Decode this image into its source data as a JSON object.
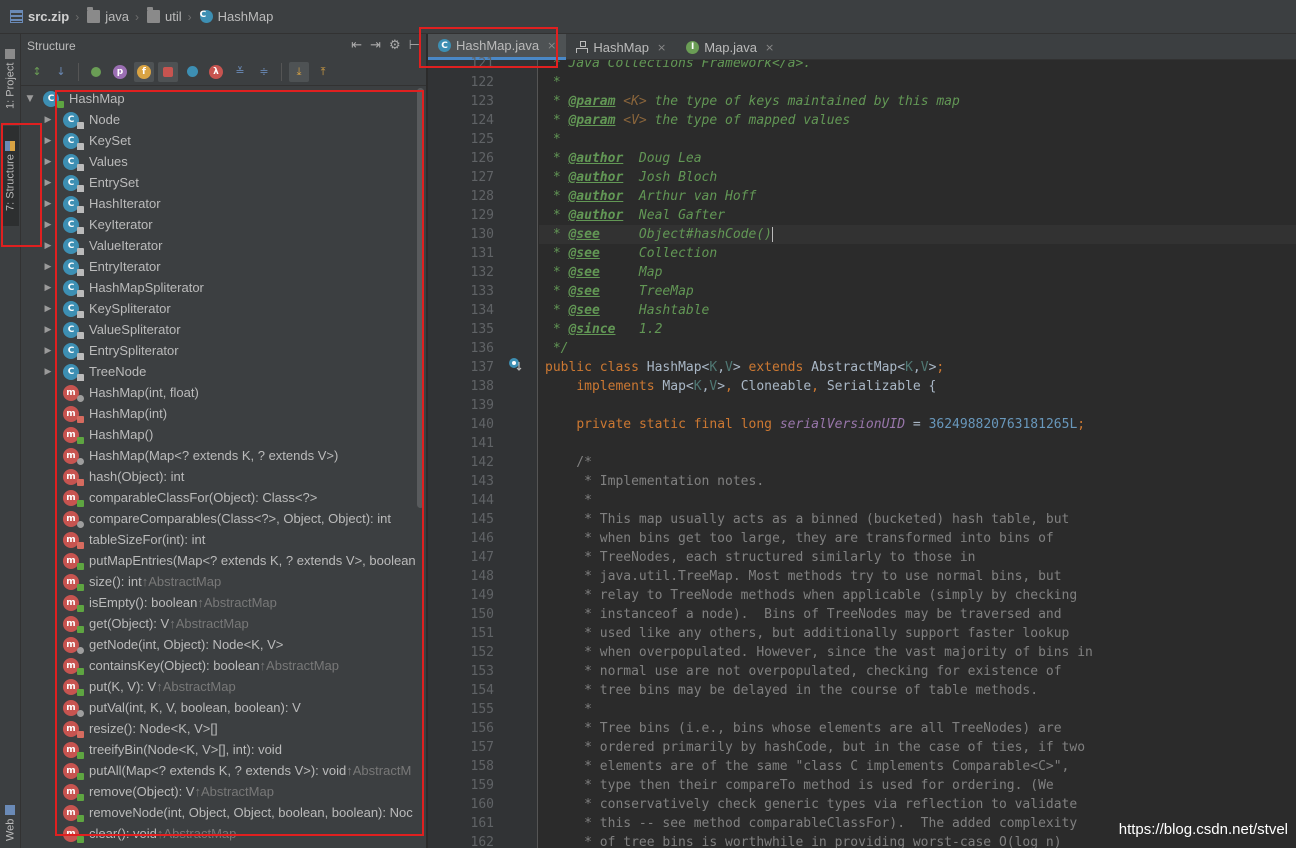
{
  "breadcrumb": {
    "items": [
      {
        "label": "src.zip",
        "icon": "zip-archive-icon"
      },
      {
        "label": "java",
        "icon": "folder-icon"
      },
      {
        "label": "util",
        "icon": "folder-icon"
      },
      {
        "label": "HashMap",
        "icon": "class-icon"
      }
    ]
  },
  "left_strip": {
    "project_tab": "1: Project",
    "structure_tab": "7: Structure",
    "web_tab": "Web"
  },
  "structure": {
    "title": "Structure",
    "root": "HashMap",
    "items": [
      {
        "kind": "class",
        "label": "Node",
        "inherited": "",
        "expandable": true
      },
      {
        "kind": "class",
        "label": "KeySet",
        "inherited": "",
        "expandable": true
      },
      {
        "kind": "class",
        "label": "Values",
        "inherited": "",
        "expandable": true
      },
      {
        "kind": "class",
        "label": "EntrySet",
        "inherited": "",
        "expandable": true
      },
      {
        "kind": "class",
        "label": "HashIterator",
        "inherited": "",
        "expandable": true
      },
      {
        "kind": "class",
        "label": "KeyIterator",
        "inherited": "",
        "expandable": true
      },
      {
        "kind": "class",
        "label": "ValueIterator",
        "inherited": "",
        "expandable": true
      },
      {
        "kind": "class",
        "label": "EntryIterator",
        "inherited": "",
        "expandable": true
      },
      {
        "kind": "class",
        "label": "HashMapSpliterator",
        "inherited": "",
        "expandable": true
      },
      {
        "kind": "class",
        "label": "KeySpliterator",
        "inherited": "",
        "expandable": true
      },
      {
        "kind": "class",
        "label": "ValueSpliterator",
        "inherited": "",
        "expandable": true
      },
      {
        "kind": "class",
        "label": "EntrySpliterator",
        "inherited": "",
        "expandable": true
      },
      {
        "kind": "class",
        "label": "TreeNode",
        "inherited": "",
        "expandable": true
      },
      {
        "kind": "method",
        "label": "HashMap(int, float)",
        "inherited": "",
        "expandable": false
      },
      {
        "kind": "method",
        "label": "HashMap(int)",
        "inherited": "",
        "expandable": false
      },
      {
        "kind": "method",
        "label": "HashMap()",
        "inherited": "",
        "expandable": false
      },
      {
        "kind": "method",
        "label": "HashMap(Map<? extends K, ? extends V>)",
        "inherited": "",
        "expandable": false
      },
      {
        "kind": "method",
        "label": "hash(Object): int",
        "inherited": "",
        "expandable": false
      },
      {
        "kind": "method",
        "label": "comparableClassFor(Object): Class<?>",
        "inherited": "",
        "expandable": false
      },
      {
        "kind": "method",
        "label": "compareComparables(Class<?>, Object, Object): int",
        "inherited": "",
        "expandable": false
      },
      {
        "kind": "method",
        "label": "tableSizeFor(int): int",
        "inherited": "",
        "expandable": false
      },
      {
        "kind": "method",
        "label": "putMapEntries(Map<? extends K, ? extends V>, boolean",
        "inherited": "",
        "expandable": false
      },
      {
        "kind": "method",
        "label": "size(): int",
        "inherited": "↑AbstractMap",
        "expandable": false
      },
      {
        "kind": "method",
        "label": "isEmpty(): boolean",
        "inherited": "↑AbstractMap",
        "expandable": false
      },
      {
        "kind": "method",
        "label": "get(Object): V",
        "inherited": "↑AbstractMap",
        "expandable": false
      },
      {
        "kind": "method",
        "label": "getNode(int, Object): Node<K, V>",
        "inherited": "",
        "expandable": false
      },
      {
        "kind": "method",
        "label": "containsKey(Object): boolean",
        "inherited": "↑AbstractMap",
        "expandable": false
      },
      {
        "kind": "method",
        "label": "put(K, V): V",
        "inherited": "↑AbstractMap",
        "expandable": false
      },
      {
        "kind": "method",
        "label": "putVal(int, K, V, boolean, boolean): V",
        "inherited": "",
        "expandable": false
      },
      {
        "kind": "method",
        "label": "resize(): Node<K, V>[]",
        "inherited": "",
        "expandable": false
      },
      {
        "kind": "method",
        "label": "treeifyBin(Node<K, V>[], int): void",
        "inherited": "",
        "expandable": false
      },
      {
        "kind": "method",
        "label": "putAll(Map<? extends K, ? extends V>): void",
        "inherited": "↑AbstractM",
        "expandable": false
      },
      {
        "kind": "method",
        "label": "remove(Object): V",
        "inherited": "↑AbstractMap",
        "expandable": false
      },
      {
        "kind": "method",
        "label": "removeNode(int, Object, Object, boolean, boolean): Noc",
        "inherited": "",
        "expandable": false
      },
      {
        "kind": "method",
        "label": "clear(): void",
        "inherited": "↑AbstractMap",
        "expandable": false
      }
    ]
  },
  "tabs": [
    {
      "label": "HashMap.java",
      "icon": "class-icon",
      "active": true
    },
    {
      "label": "HashMap",
      "icon": "hierarchy-icon",
      "active": false
    },
    {
      "label": "Map.java",
      "icon": "interface-icon",
      "active": false
    }
  ],
  "editor": {
    "first_line": 121,
    "current_line": 130,
    "lines": [
      " * Java Collections Framework</a>.",
      " *",
      " * @param <K> the type of keys maintained by this map",
      " * @param <V> the type of mapped values",
      " *",
      " * @author  Doug Lea",
      " * @author  Josh Bloch",
      " * @author  Arthur van Hoff",
      " * @author  Neal Gafter",
      " * @see     Object#hashCode()",
      " * @see     Collection",
      " * @see     Map",
      " * @see     TreeMap",
      " * @see     Hashtable",
      " * @since   1.2",
      " */",
      "public class HashMap<K,V> extends AbstractMap<K,V>",
      "    implements Map<K,V>, Cloneable, Serializable {",
      "",
      "    private static final long serialVersionUID = 362498820763181265L;",
      "",
      "    /*",
      "     * Implementation notes.",
      "     *",
      "     * This map usually acts as a binned (bucketed) hash table, but",
      "     * when bins get too large, they are transformed into bins of",
      "     * TreeNodes, each structured similarly to those in",
      "     * java.util.TreeMap. Most methods try to use normal bins, but",
      "     * relay to TreeNode methods when applicable (simply by checking",
      "     * instanceof a node).  Bins of TreeNodes may be traversed and",
      "     * used like any others, but additionally support faster lookup",
      "     * when overpopulated. However, since the vast majority of bins in",
      "     * normal use are not overpopulated, checking for existence of",
      "     * tree bins may be delayed in the course of table methods.",
      "     *",
      "     * Tree bins (i.e., bins whose elements are all TreeNodes) are",
      "     * ordered primarily by hashCode, but in the case of ties, if two",
      "     * elements are of the same \"class C implements Comparable<C>\",",
      "     * type then their compareTo method is used for ordering. (We",
      "     * conservatively check generic types via reflection to validate",
      "     * this -- see method comparableClassFor).  The added complexity",
      "     * of tree bins is worthwhile in providing worst-case O(log n)"
    ]
  },
  "watermark": "https://blog.csdn.net/stvel",
  "colors": {
    "highlight": "#e02020",
    "accent": "#4a88c7",
    "class_icon": "#3d8fb3",
    "method_icon": "#c75450"
  }
}
